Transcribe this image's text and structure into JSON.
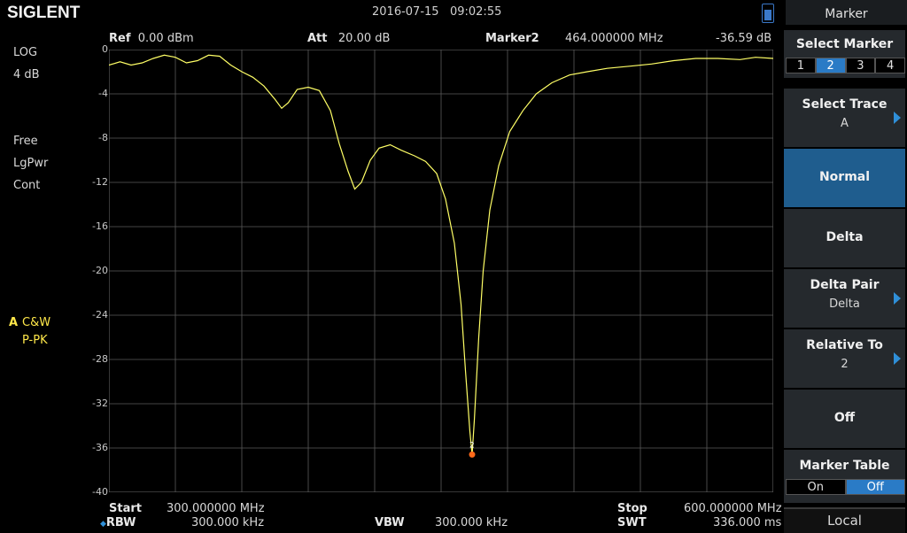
{
  "brand": "SIGLENT",
  "status": {
    "date": "2016-07-15",
    "time": "09:02:55"
  },
  "header": {
    "ref_label": "Ref",
    "ref_value": "0.00 dBm",
    "att_label": "Att",
    "att_value": "20.00 dB",
    "marker_label": "Marker2",
    "marker_freq": "464.000000 MHz",
    "marker_level": "-36.59 dB"
  },
  "left_panel": {
    "scale_type": "LOG",
    "scale_div": "4 dB",
    "trigger": "Free",
    "detector_power": "LgPwr",
    "sweep_mode": "Cont",
    "trace_letter": "A",
    "trace_mode": "C&W",
    "trace_detector": "P-PK"
  },
  "y_ticks": [
    "0",
    "-4",
    "-8",
    "-12",
    "-16",
    "-20",
    "-24",
    "-28",
    "-32",
    "-36",
    "-40"
  ],
  "bottom": {
    "start_label": "Start",
    "start_value": "300.000000 MHz",
    "stop_label": "Stop",
    "stop_value": "600.000000 MHz",
    "rbw_label": "RBW",
    "rbw_value": "300.000 kHz",
    "vbw_label": "VBW",
    "vbw_value": "300.000 kHz",
    "swt_label": "SWT",
    "swt_value": "336.000 ms"
  },
  "menu": {
    "title": "Marker",
    "select_marker": {
      "label": "Select Marker",
      "options": [
        "1",
        "2",
        "3",
        "4"
      ],
      "selected": "2"
    },
    "select_trace": {
      "label": "Select Trace",
      "value": "A"
    },
    "normal": {
      "label": "Normal"
    },
    "delta": {
      "label": "Delta"
    },
    "delta_pair": {
      "label": "Delta Pair",
      "value": "Delta"
    },
    "relative_to": {
      "label": "Relative To",
      "value": "2"
    },
    "off": {
      "label": "Off"
    },
    "marker_table": {
      "label": "Marker Table",
      "on": "On",
      "off": "Off",
      "selected": "Off"
    },
    "local": "Local"
  },
  "marker": {
    "number": "2",
    "freq_mhz": 464,
    "level_db": -36.59
  },
  "trace": {
    "color": "#ffff66",
    "points_mhz_db": [
      [
        300,
        -1.4
      ],
      [
        305,
        -1.1
      ],
      [
        310,
        -1.4
      ],
      [
        315,
        -1.2
      ],
      [
        320,
        -0.8
      ],
      [
        325,
        -0.5
      ],
      [
        330,
        -0.7
      ],
      [
        335,
        -1.2
      ],
      [
        340,
        -1.0
      ],
      [
        345,
        -0.5
      ],
      [
        350,
        -0.6
      ],
      [
        355,
        -1.4
      ],
      [
        360,
        -2.0
      ],
      [
        365,
        -2.5
      ],
      [
        370,
        -3.3
      ],
      [
        375,
        -4.5
      ],
      [
        378,
        -5.3
      ],
      [
        381,
        -4.8
      ],
      [
        385,
        -3.6
      ],
      [
        390,
        -3.4
      ],
      [
        395,
        -3.7
      ],
      [
        400,
        -5.5
      ],
      [
        404,
        -8.5
      ],
      [
        408,
        -11.0
      ],
      [
        411,
        -12.6
      ],
      [
        414,
        -12.0
      ],
      [
        418,
        -10.0
      ],
      [
        422,
        -8.9
      ],
      [
        427,
        -8.6
      ],
      [
        432,
        -9.1
      ],
      [
        438,
        -9.6
      ],
      [
        443,
        -10.1
      ],
      [
        448,
        -11.2
      ],
      [
        452,
        -13.5
      ],
      [
        456,
        -17.5
      ],
      [
        459,
        -23.0
      ],
      [
        461,
        -29.0
      ],
      [
        463,
        -34.5
      ],
      [
        464,
        -36.59
      ],
      [
        465,
        -33.5
      ],
      [
        467,
        -26.0
      ],
      [
        469,
        -20.0
      ],
      [
        472,
        -14.5
      ],
      [
        476,
        -10.5
      ],
      [
        481,
        -7.4
      ],
      [
        487,
        -5.5
      ],
      [
        493,
        -4.0
      ],
      [
        500,
        -3.0
      ],
      [
        508,
        -2.3
      ],
      [
        516,
        -2.0
      ],
      [
        525,
        -1.7
      ],
      [
        535,
        -1.5
      ],
      [
        545,
        -1.3
      ],
      [
        555,
        -1.0
      ],
      [
        565,
        -0.8
      ],
      [
        575,
        -0.8
      ],
      [
        585,
        -0.9
      ],
      [
        592,
        -0.7
      ],
      [
        600,
        -0.8
      ]
    ]
  }
}
